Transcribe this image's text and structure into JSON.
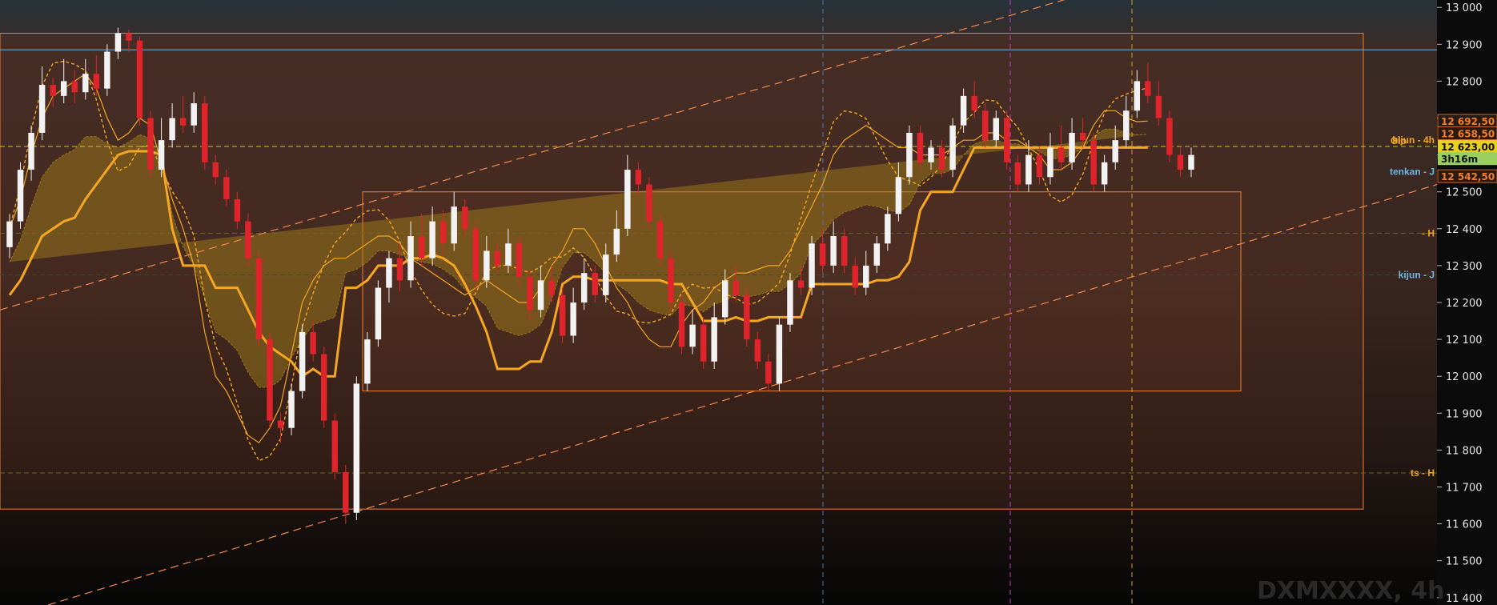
{
  "watermark": "DXMXXXX, 4h",
  "colors": {
    "bull": "#f2f2f2",
    "bear": "#e0242c",
    "kijun": "#f5a623",
    "tenkan": "#f5a623",
    "cloud": "#a8861a",
    "box": "#f08030",
    "channel": "#f08a50",
    "hline_blue": "#6fb8e0",
    "hline_yellow": "#c8c820",
    "vline_blue": "#4a78b0",
    "vline_magenta": "#c040c0",
    "vline_orange": "#d0a020"
  },
  "chart_data": {
    "type": "candlestick",
    "y_axis": {
      "range": [
        11380,
        13020
      ],
      "ticks": [
        "13 000",
        "12 900",
        "12 800",
        "12 700",
        "12 600",
        "12 500",
        "12 400",
        "12 300",
        "12 200",
        "12 100",
        "12 000",
        "11 900",
        "11 800",
        "11 700",
        "11 600",
        "11 500",
        "11 400"
      ]
    },
    "price_labels": [
      {
        "text": "12 692,50",
        "value": 12692.5,
        "color": "#f08030",
        "bg": "#2a1a10"
      },
      {
        "text": "12 658,50",
        "value": 12658.5,
        "color": "#f08030",
        "bg": "#2a1a10"
      },
      {
        "text": "12 623,00",
        "value": 12623,
        "color": "#101010",
        "bg": "#e8d020"
      },
      {
        "text": "3h16m",
        "value": 12590,
        "color": "#101010",
        "bg": "#9ad060"
      },
      {
        "text": "12 542,50",
        "value": 12542.5,
        "color": "#f08030",
        "bg": "#2a1a10"
      }
    ],
    "indicator_labels": [
      {
        "text": "kijun - 4h",
        "value": 12640,
        "color": "#f5a623"
      },
      {
        "text": "Olo",
        "value": 12638,
        "color": "#f5a623"
      },
      {
        "text": "tenkan - J",
        "value": 12555,
        "color": "#6fb8e0"
      },
      {
        "text": "- H",
        "value": 12388,
        "color": "#f5a623"
      },
      {
        "text": "kijun - J",
        "value": 12275,
        "color": "#6fb8e0"
      },
      {
        "text": "ts - H",
        "value": 11738,
        "color": "#f5a623"
      }
    ],
    "horizontal_levels": [
      {
        "value": 12885,
        "style": "solid",
        "color": "#6fb8e0"
      },
      {
        "value": 12623,
        "style": "dashed",
        "color": "#c8c820"
      },
      {
        "value": 12388,
        "style": "dashed",
        "color": "#6a6a20"
      },
      {
        "value": 12275,
        "style": "dashed",
        "color": "#3a4a30"
      },
      {
        "value": 11738,
        "style": "dashed",
        "color": "#6a6a20"
      }
    ],
    "candles": [
      [
        12350,
        12420,
        12320,
        12440
      ],
      [
        12420,
        12560,
        12400,
        12580
      ],
      [
        12560,
        12660,
        12530,
        12680
      ],
      [
        12660,
        12790,
        12640,
        12840
      ],
      [
        12790,
        12760,
        12730,
        12810
      ],
      [
        12760,
        12800,
        12740,
        12860
      ],
      [
        12800,
        12770,
        12740,
        12830
      ],
      [
        12770,
        12820,
        12750,
        12860
      ],
      [
        12820,
        12780,
        12760,
        12870
      ],
      [
        12780,
        12880,
        12760,
        12900
      ],
      [
        12880,
        12930,
        12860,
        12945
      ],
      [
        12930,
        12910,
        12880,
        12940
      ],
      [
        12910,
        12700,
        12680,
        12920
      ],
      [
        12700,
        12560,
        12540,
        12720
      ],
      [
        12560,
        12640,
        12540,
        12700
      ],
      [
        12640,
        12700,
        12620,
        12740
      ],
      [
        12700,
        12680,
        12660,
        12760
      ],
      [
        12680,
        12740,
        12660,
        12770
      ],
      [
        12740,
        12580,
        12560,
        12760
      ],
      [
        12580,
        12540,
        12520,
        12600
      ],
      [
        12540,
        12480,
        12460,
        12560
      ],
      [
        12480,
        12420,
        12400,
        12500
      ],
      [
        12420,
        12320,
        12300,
        12440
      ],
      [
        12320,
        12100,
        12080,
        12340
      ],
      [
        12100,
        11880,
        11860,
        12120
      ],
      [
        11880,
        11860,
        11820,
        11900
      ],
      [
        11860,
        11960,
        11840,
        11980
      ],
      [
        11960,
        12120,
        11940,
        12140
      ],
      [
        12120,
        12060,
        12040,
        12150
      ],
      [
        12060,
        11880,
        11860,
        12080
      ],
      [
        11880,
        11740,
        11720,
        11900
      ],
      [
        11740,
        11630,
        11600,
        11760
      ],
      [
        11630,
        11980,
        11610,
        12000
      ],
      [
        11980,
        12100,
        11960,
        12120
      ],
      [
        12100,
        12240,
        12080,
        12260
      ],
      [
        12240,
        12320,
        12200,
        12340
      ],
      [
        12320,
        12260,
        12230,
        12360
      ],
      [
        12260,
        12380,
        12240,
        12420
      ],
      [
        12380,
        12320,
        12300,
        12440
      ],
      [
        12320,
        12420,
        12300,
        12460
      ],
      [
        12420,
        12360,
        12330,
        12450
      ],
      [
        12360,
        12460,
        12340,
        12500
      ],
      [
        12460,
        12400,
        12380,
        12480
      ],
      [
        12400,
        12260,
        12230,
        12420
      ],
      [
        12260,
        12340,
        12240,
        12380
      ],
      [
        12340,
        12300,
        12280,
        12360
      ],
      [
        12300,
        12360,
        12280,
        12400
      ],
      [
        12360,
        12270,
        12240,
        12380
      ],
      [
        12270,
        12180,
        12150,
        12290
      ],
      [
        12180,
        12260,
        12160,
        12300
      ],
      [
        12260,
        12220,
        12200,
        12300
      ],
      [
        12220,
        12110,
        12090,
        12240
      ],
      [
        12110,
        12200,
        12090,
        12240
      ],
      [
        12200,
        12280,
        12180,
        12320
      ],
      [
        12280,
        12220,
        12200,
        12300
      ],
      [
        12220,
        12330,
        12200,
        12360
      ],
      [
        12330,
        12400,
        12310,
        12450
      ],
      [
        12400,
        12560,
        12380,
        12600
      ],
      [
        12560,
        12520,
        12490,
        12580
      ],
      [
        12520,
        12420,
        12400,
        12540
      ],
      [
        12420,
        12320,
        12300,
        12440
      ],
      [
        12320,
        12200,
        12180,
        12340
      ],
      [
        12200,
        12080,
        12060,
        12220
      ],
      [
        12080,
        12140,
        12060,
        12180
      ],
      [
        12140,
        12040,
        12020,
        12160
      ],
      [
        12040,
        12160,
        12020,
        12200
      ],
      [
        12160,
        12260,
        12140,
        12290
      ],
      [
        12260,
        12220,
        12200,
        12300
      ],
      [
        12220,
        12100,
        12080,
        12240
      ],
      [
        12100,
        12040,
        12020,
        12120
      ],
      [
        12040,
        11980,
        11960,
        12060
      ],
      [
        11980,
        12140,
        11960,
        12160
      ],
      [
        12140,
        12260,
        12120,
        12280
      ],
      [
        12260,
        12240,
        12220,
        12300
      ],
      [
        12240,
        12360,
        12220,
        12380
      ],
      [
        12360,
        12300,
        12280,
        12400
      ],
      [
        12300,
        12380,
        12280,
        12420
      ],
      [
        12380,
        12300,
        12280,
        12400
      ],
      [
        12300,
        12240,
        12220,
        12320
      ],
      [
        12240,
        12300,
        12220,
        12340
      ],
      [
        12300,
        12360,
        12280,
        12380
      ],
      [
        12360,
        12440,
        12340,
        12460
      ],
      [
        12440,
        12540,
        12420,
        12580
      ],
      [
        12540,
        12660,
        12520,
        12680
      ],
      [
        12660,
        12580,
        12560,
        12680
      ],
      [
        12580,
        12620,
        12560,
        12640
      ],
      [
        12620,
        12560,
        12540,
        12640
      ],
      [
        12560,
        12680,
        12540,
        12700
      ],
      [
        12680,
        12760,
        12660,
        12780
      ],
      [
        12760,
        12720,
        12700,
        12800
      ],
      [
        12720,
        12640,
        12620,
        12740
      ],
      [
        12640,
        12700,
        12620,
        12720
      ],
      [
        12700,
        12580,
        12560,
        12720
      ],
      [
        12580,
        12520,
        12500,
        12600
      ],
      [
        12520,
        12600,
        12500,
        12640
      ],
      [
        12600,
        12540,
        12520,
        12620
      ],
      [
        12540,
        12620,
        12520,
        12660
      ],
      [
        12620,
        12580,
        12560,
        12680
      ],
      [
        12580,
        12660,
        12560,
        12700
      ],
      [
        12660,
        12640,
        12620,
        12700
      ],
      [
        12640,
        12520,
        12500,
        12660
      ],
      [
        12520,
        12580,
        12500,
        12600
      ],
      [
        12580,
        12640,
        12560,
        12680
      ],
      [
        12640,
        12720,
        12620,
        12760
      ],
      [
        12720,
        12800,
        12700,
        12830
      ],
      [
        12800,
        12760,
        12740,
        12850
      ],
      [
        12760,
        12700,
        12680,
        12800
      ],
      [
        12700,
        12600,
        12580,
        12720
      ],
      [
        12600,
        12560,
        12540,
        12620
      ],
      [
        12560,
        12600,
        12540,
        12620
      ]
    ],
    "kijun_4h": [
      12220,
      12260,
      12320,
      12380,
      12400,
      12420,
      12430,
      12480,
      12520,
      12560,
      12600,
      12610,
      12610,
      12610,
      12600,
      12400,
      12300,
      12300,
      12300,
      12240,
      12240,
      12240,
      12180,
      12120,
      12080,
      12060,
      12040,
      12000,
      12020,
      12000,
      12000,
      12240,
      12240,
      12260,
      12300,
      12300,
      12300,
      12320,
      12320,
      12330,
      12320,
      12300,
      12250,
      12190,
      12120,
      12020,
      12020,
      12020,
      12040,
      12040,
      12120,
      12250,
      12270,
      12270,
      12260,
      12260,
      12260,
      12260,
      12260,
      12260,
      12260,
      12250,
      12250,
      12200,
      12150,
      12150,
      12150,
      12160,
      12150,
      12150,
      12160,
      12160,
      12160,
      12160,
      12250,
      12250,
      12250,
      12250,
      12250,
      12250,
      12260,
      12260,
      12270,
      12310,
      12450,
      12500,
      12500,
      12500,
      12560,
      12620,
      12620,
      12620,
      12620,
      12620,
      12620,
      12620,
      12620,
      12620,
      12620,
      12620,
      12620,
      12620,
      12620,
      12620,
      12620,
      12620
    ],
    "tenkan_4h": [
      12400,
      12480,
      12600,
      12700,
      12760,
      12780,
      12800,
      12820,
      12780,
      12700,
      12640,
      12660,
      12700,
      12680,
      12580,
      12480,
      12400,
      12300,
      12120,
      12000,
      11960,
      11900,
      11840,
      11820,
      11860,
      11920,
      12060,
      12200,
      12260,
      12300,
      12320,
      12320,
      12340,
      12360,
      12380,
      12380,
      12360,
      12320,
      12300,
      12280,
      12260,
      12240,
      12220,
      12240,
      12260,
      12240,
      12220,
      12200,
      12200,
      12240,
      12300,
      12340,
      12400,
      12400,
      12360,
      12300,
      12240,
      12200,
      12140,
      12100,
      12080,
      12080,
      12140,
      12180,
      12200,
      12240,
      12260,
      12280,
      12280,
      12290,
      12300,
      12300,
      12340,
      12400,
      12460,
      12520,
      12600,
      12640,
      12660,
      12680,
      12660,
      12640,
      12620,
      12620,
      12600,
      12600,
      12600,
      12620,
      12640,
      12640,
      12660,
      12660,
      12640,
      12640,
      12620,
      12600,
      12560,
      12560,
      12580,
      12620,
      12680,
      12720,
      12720,
      12700,
      12690,
      12692
    ]
  }
}
